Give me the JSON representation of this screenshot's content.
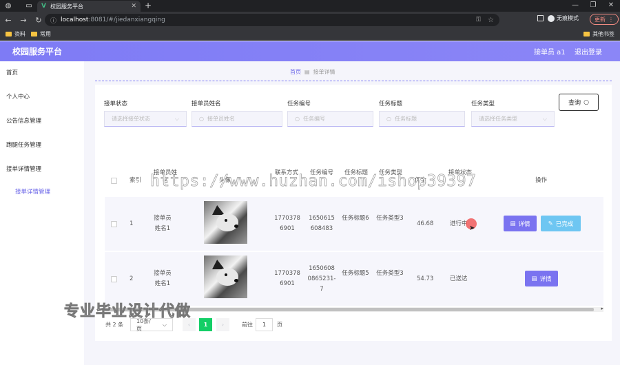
{
  "browser": {
    "tab_title": "校园服务平台",
    "url_host": "localhost",
    "url_rest": ":8081/#/jiedanxiangqing",
    "incognito_label": "无痕模式",
    "update_label": "更新",
    "bookmarks": [
      {
        "label": "资料"
      },
      {
        "label": "常用"
      }
    ],
    "other_bookmarks": "其他书签"
  },
  "header": {
    "title": "校园服务平台",
    "user": "接单员 a1",
    "logout": "退出登录"
  },
  "sidebar": {
    "items": [
      {
        "label": "首页"
      },
      {
        "label": "个人中心"
      },
      {
        "label": "公告信息管理"
      },
      {
        "label": "跑腿任务管理"
      },
      {
        "label": "接单详情管理"
      }
    ],
    "sub_item": "接单详情管理"
  },
  "breadcrumb": {
    "home": "首页",
    "current": "接单详情"
  },
  "filters": [
    {
      "label": "接单状态",
      "placeholder": "请选择接单状态"
    },
    {
      "label": "接单员姓名",
      "placeholder": "接单员姓名"
    },
    {
      "label": "任务编号",
      "placeholder": "任务编号"
    },
    {
      "label": "任务标题",
      "placeholder": "任务标题"
    },
    {
      "label": "任务类型",
      "placeholder": "请选择任务类型"
    }
  ],
  "query_button": "查询",
  "table": {
    "headers": {
      "index": "索引",
      "name": "接单员姓名",
      "photo": "头像",
      "phone": "联系方式",
      "task_no": "任务编号",
      "task_title": "任务标题",
      "task_type": "任务类型",
      "amount": "佣金",
      "status": "接单状态",
      "ops": "操作"
    },
    "rows": [
      {
        "index": "1",
        "name": "接单员姓名1",
        "phone": "17703786901",
        "task_no": "1650615608483",
        "task_title": "任务标题6",
        "task_type": "任务类型3",
        "amount": "46.68",
        "status": "进行中",
        "detail_label": "详情",
        "done_label": "已完成"
      },
      {
        "index": "2",
        "name": "接单员姓名1",
        "phone": "17703786901",
        "task_no": "16506080865231-7",
        "task_title": "任务标题5",
        "task_type": "任务类型3",
        "amount": "54.73",
        "status": "已送达",
        "detail_label": "详情"
      }
    ]
  },
  "pagination": {
    "total": "共 2 条",
    "page_size": "10条/页",
    "current_page": "1",
    "goto_label": "前往",
    "goto_value": "1",
    "page_unit": "页"
  },
  "watermark_text": "https://www.huzhan.com/ishop39397",
  "watermark_text2": "专业毕业设计代做"
}
